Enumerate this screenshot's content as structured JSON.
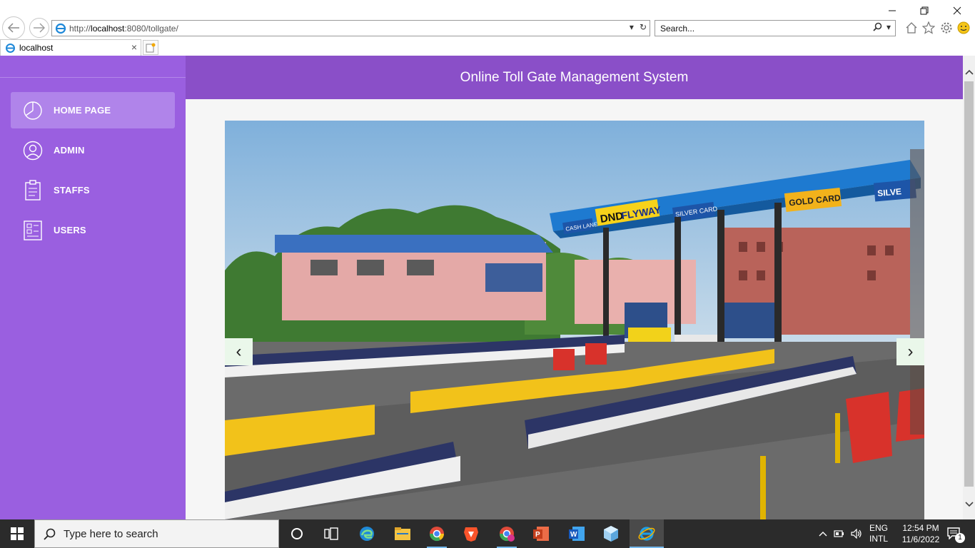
{
  "browser": {
    "url_prefix": "http://",
    "url_host": "localhost",
    "url_rest": ":8080/tollgate/",
    "search_placeholder": "Search...",
    "tab_title": "localhost"
  },
  "sidebar": {
    "items": [
      {
        "label": "HOME PAGE",
        "icon": "pie-chart-icon",
        "active": true
      },
      {
        "label": "ADMIN",
        "icon": "user-icon",
        "active": false
      },
      {
        "label": "STAFFS",
        "icon": "clipboard-icon",
        "active": false
      },
      {
        "label": "USERS",
        "icon": "users-list-icon",
        "active": false
      }
    ]
  },
  "header": {
    "title": "Online Toll Gate Management System"
  },
  "carousel": {
    "prev_label": "‹",
    "next_label": "›",
    "signs": {
      "dnd": "DND",
      "flyway": "FLYWAY",
      "cash_lane": "CASH LANE",
      "silver_card": "SILVER CARD",
      "gold_card": "GOLD CARD",
      "silver_cut": "SILVE"
    }
  },
  "taskbar": {
    "search_placeholder": "Type here to search",
    "language_line1": "ENG",
    "language_line2": "INTL",
    "time": "12:54 PM",
    "date": "11/6/2022",
    "notification_count": "1"
  },
  "colors": {
    "sidebar_bg": "#9a5fe0",
    "header_bg": "#8a4fc8",
    "active_menu_bg": "#b084ea"
  }
}
